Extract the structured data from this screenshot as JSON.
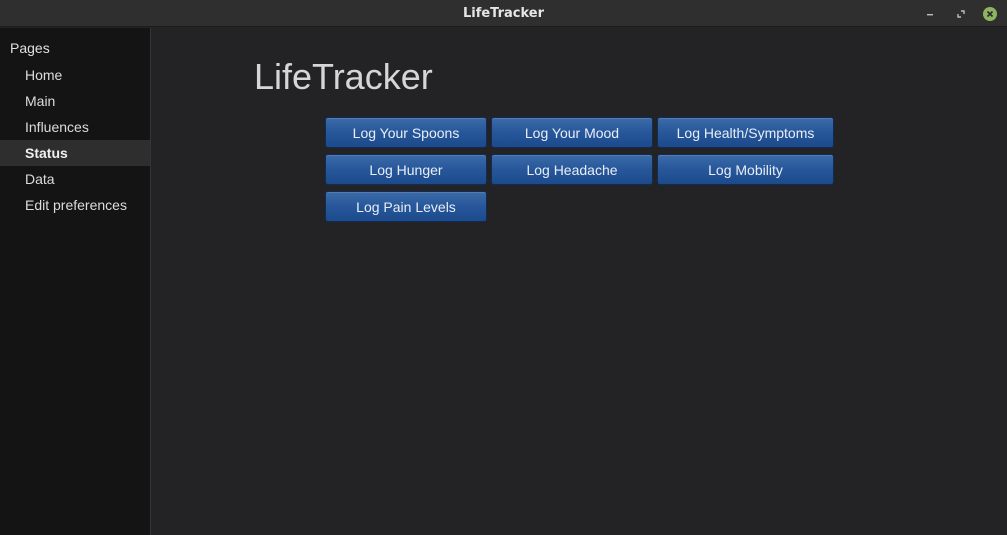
{
  "window": {
    "title": "LifeTracker"
  },
  "sidebar": {
    "heading": "Pages",
    "items": [
      {
        "label": "Home"
      },
      {
        "label": "Main"
      },
      {
        "label": "Influences"
      },
      {
        "label": "Status",
        "active": true
      },
      {
        "label": "Data"
      },
      {
        "label": "Edit preferences"
      }
    ]
  },
  "main": {
    "title": "LifeTracker",
    "buttons": [
      {
        "label": "Log Your Spoons"
      },
      {
        "label": "Log Your Mood"
      },
      {
        "label": "Log Health/Symptoms"
      },
      {
        "label": "Log Hunger"
      },
      {
        "label": "Log Headache"
      },
      {
        "label": "Log Mobility"
      },
      {
        "label": "Log Pain Levels"
      }
    ]
  },
  "colors": {
    "accent": "#27579a",
    "close_button": "#8fb360",
    "background": "#232325",
    "sidebar": "#141414"
  },
  "icons": {
    "minimize": "minimize-icon",
    "maximize": "maximize-icon",
    "close": "close-icon"
  }
}
